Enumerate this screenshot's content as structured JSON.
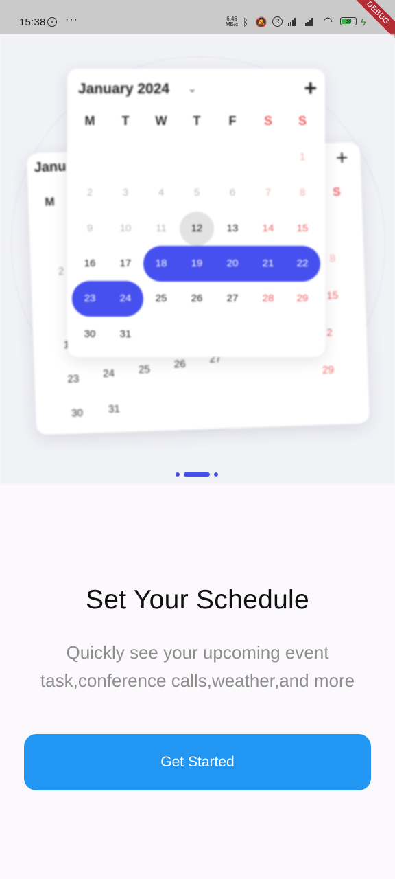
{
  "status_bar": {
    "time": "15:38",
    "notif_icon": "x-circle-icon",
    "more": "···",
    "speed_value": "6,46",
    "speed_unit": "МБ/с",
    "battery_level": "38",
    "debug_banner": "DEBUG"
  },
  "calendar_back": {
    "title": "Janu",
    "weekday_first": "M",
    "weekday_last": "S",
    "days": [
      "1",
      "8",
      "15",
      "2",
      "29",
      "2",
      "1",
      "23",
      "24",
      "25",
      "26",
      "27",
      "30",
      "31"
    ]
  },
  "calendar_front": {
    "month": "January 2024",
    "weekdays": [
      "M",
      "T",
      "W",
      "T",
      "F",
      "S",
      "S"
    ],
    "weeks": [
      [
        "",
        "",
        "",
        "",
        "",
        "",
        "1"
      ],
      [
        "2",
        "3",
        "4",
        "5",
        "6",
        "7",
        "8"
      ],
      [
        "9",
        "10",
        "11",
        "12",
        "13",
        "14",
        "15"
      ],
      [
        "16",
        "17",
        "18",
        "19",
        "20",
        "21",
        "22"
      ],
      [
        "23",
        "24",
        "25",
        "26",
        "27",
        "28",
        "29"
      ],
      [
        "30",
        "31",
        "",
        "",
        "",
        "",
        ""
      ]
    ],
    "today": "12",
    "selected_days": [
      "18",
      "19",
      "20",
      "21",
      "22",
      "23",
      "24"
    ]
  },
  "onboarding": {
    "title": "Set Your Schedule",
    "subtitle_line1": "Quickly see your upcoming event",
    "subtitle_line2": "task,conference calls,weather,and more",
    "button": "Get Started",
    "page_index": 2,
    "page_count": 3
  },
  "colors": {
    "accent": "#4650ee",
    "button": "#2196f3",
    "weekend": "#ee5e5e"
  }
}
